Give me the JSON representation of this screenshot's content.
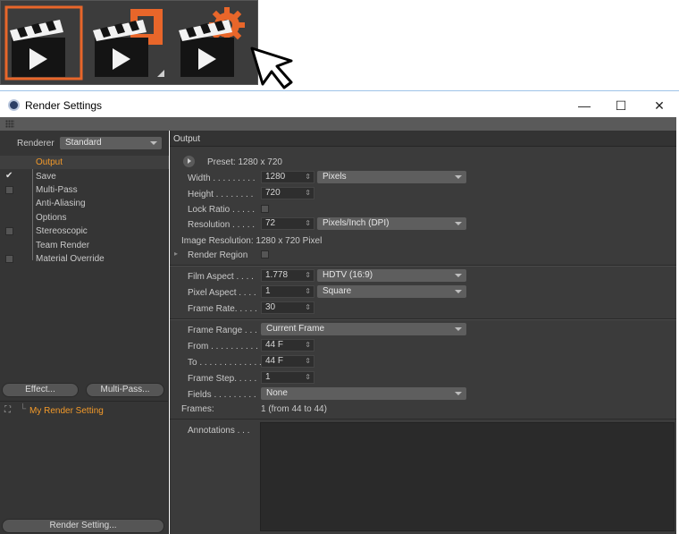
{
  "window": {
    "title": "Render Settings",
    "minimize": "—",
    "maximize": "☐",
    "close": "✕"
  },
  "toolbar_icons": [
    "render-view-icon",
    "render-to-picture-viewer-icon",
    "edit-render-settings-icon"
  ],
  "left": {
    "renderer_label": "Renderer",
    "renderer_value": "Standard",
    "tree": [
      {
        "label": "Output",
        "selected": true,
        "check": ""
      },
      {
        "label": "Save",
        "check": "✔"
      },
      {
        "label": "Multi-Pass",
        "check": "box"
      },
      {
        "label": "Anti-Aliasing",
        "check": ""
      },
      {
        "label": "Options",
        "check": ""
      },
      {
        "label": "Stereoscopic",
        "check": "box"
      },
      {
        "label": "Team Render",
        "check": ""
      },
      {
        "label": "Material Override",
        "check": "box"
      }
    ],
    "effect_button": "Effect...",
    "multipass_button": "Multi-Pass...",
    "setting_name": "My Render Setting",
    "render_setting_button": "Render Setting..."
  },
  "output": {
    "header": "Output",
    "preset": "Preset: 1280 x 720",
    "width_label": "Width . . . . . . . . .",
    "width_value": "1280",
    "width_unit": "Pixels",
    "height_label": "Height . . . . . . . .",
    "height_value": "720",
    "lock_ratio_label": "Lock Ratio . . . . .",
    "resolution_label": "Resolution . . . . .",
    "resolution_value": "72",
    "resolution_unit": "Pixels/Inch (DPI)",
    "image_resolution": "Image Resolution: 1280 x 720 Pixel",
    "render_region_label": "Render Region",
    "film_aspect_label": "Film Aspect . . . .",
    "film_aspect_value": "1.778",
    "film_aspect_preset": "HDTV (16:9)",
    "pixel_aspect_label": "Pixel Aspect . . . .",
    "pixel_aspect_value": "1",
    "pixel_aspect_preset": "Square",
    "frame_rate_label": "Frame Rate. . . . .",
    "frame_rate_value": "30",
    "frame_range_label": "Frame Range . . .",
    "frame_range_value": "Current Frame",
    "from_label": "From . . . . . . . . . .",
    "from_value": "44 F",
    "to_label": "To . . . . . . . . . . . . .",
    "to_value": "44 F",
    "frame_step_label": "Frame Step. . . . .",
    "frame_step_value": "1",
    "fields_label": "Fields . . . . . . . . .",
    "fields_value": "None",
    "frames_label": "Frames:",
    "frames_value": "1 (from 44 to 44)",
    "annotations_label": "Annotations . . ."
  },
  "colors": {
    "accent": "#f39a2a",
    "panel": "#3b3b3b"
  }
}
